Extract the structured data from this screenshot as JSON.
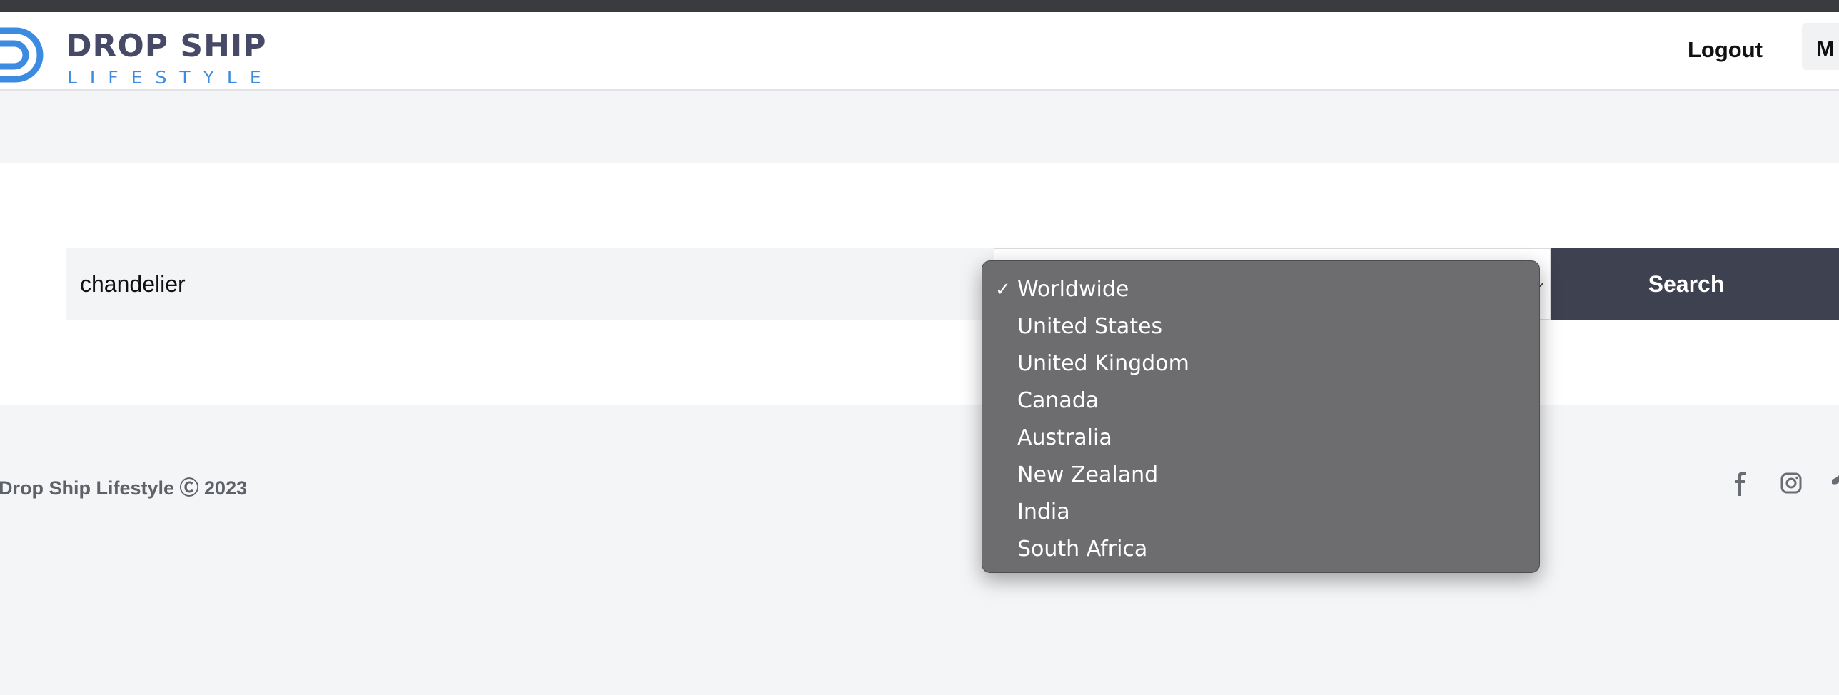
{
  "brand": {
    "name_top": "DROP SHIP",
    "name_bottom": "LIFESTYLE",
    "logo_colors": {
      "dark": "#474a67",
      "accent": "#3d8be0"
    }
  },
  "header": {
    "logout_label": "Logout",
    "menu_label": "M"
  },
  "search": {
    "query": "chandelier",
    "region_selected": "Worldwide",
    "button_label": "Search"
  },
  "region_dropdown": {
    "selected": "Worldwide",
    "options": [
      "Worldwide",
      "United States",
      "United Kingdom",
      "Canada",
      "Australia",
      "New Zealand",
      "India",
      "South Africa"
    ]
  },
  "footer": {
    "copyright": "Drop Ship Lifestyle Ⓒ 2023",
    "social_icons": [
      "facebook-icon",
      "instagram-icon",
      "twitter-icon"
    ]
  },
  "colors": {
    "top_strip": "#3a3b3f",
    "search_button": "#3e4150",
    "page_bg": "#f4f5f7",
    "dropdown_bg": "#68686a"
  }
}
